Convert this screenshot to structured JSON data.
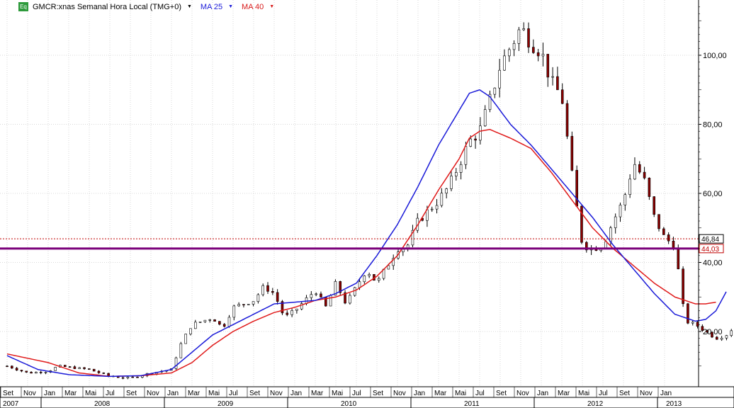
{
  "header": {
    "badge": "Eq",
    "symbol_title": "GMCR:xnas Semanal Hora Local (TMG+0)",
    "ma25_label": "MA 25",
    "ma40_label": "MA 40"
  },
  "colors": {
    "ma25": "#1a1ad8",
    "ma40": "#e01a1a",
    "support_line": "#7a007a",
    "last_price_line": "#c00000",
    "candle_up": "#ffffff",
    "candle_down": "#8b0000",
    "grid": "#d8d8d8"
  },
  "chart_data": {
    "type": "candlestick",
    "ylim": [
      4,
      116
    ],
    "yticks": [
      20,
      40,
      60,
      80,
      100
    ],
    "ytick_labels": [
      "20,00",
      "40,00",
      "60,00",
      "80,00",
      "100,00"
    ],
    "grid": true,
    "month_ticks": [
      "Set",
      "Nov",
      "Jan",
      "Mar",
      "Mai",
      "Jul",
      "Set",
      "Nov",
      "Jan",
      "Mar",
      "Mai",
      "Jul",
      "Set",
      "Nov",
      "Jan",
      "Mar",
      "Mai",
      "Jul",
      "Set",
      "Nov",
      "Jan",
      "Mar",
      "Mai",
      "Jul",
      "Set",
      "Nov",
      "Jan",
      "Mar",
      "Mai",
      "Jul",
      "Set",
      "Nov",
      "Jan"
    ],
    "year_labels": [
      "2007",
      "2008",
      "2009",
      "2010",
      "2011",
      "2012",
      "2013"
    ],
    "year_boundaries_month_index": [
      2,
      8,
      14,
      20,
      26,
      32
    ],
    "price_anchors": [
      [
        0,
        10
      ],
      [
        2,
        8
      ],
      [
        4,
        8.5
      ],
      [
        5,
        10
      ],
      [
        8,
        9
      ],
      [
        10,
        7
      ],
      [
        12,
        6.5
      ],
      [
        14,
        8
      ],
      [
        16,
        9
      ],
      [
        17,
        17
      ],
      [
        18,
        22
      ],
      [
        20,
        24
      ],
      [
        21,
        21
      ],
      [
        22,
        27
      ],
      [
        24,
        29
      ],
      [
        25,
        33
      ],
      [
        26,
        31
      ],
      [
        27,
        24
      ],
      [
        28,
        26
      ],
      [
        30,
        32
      ],
      [
        31,
        27
      ],
      [
        32,
        34
      ],
      [
        33,
        28
      ],
      [
        35,
        38
      ],
      [
        36,
        34
      ],
      [
        38,
        44
      ],
      [
        39,
        45
      ],
      [
        40,
        52
      ],
      [
        42,
        58
      ],
      [
        43,
        62
      ],
      [
        45,
        75
      ],
      [
        46,
        78
      ],
      [
        47,
        87
      ],
      [
        48,
        97
      ],
      [
        50,
        108
      ],
      [
        51,
        104
      ],
      [
        52,
        101
      ],
      [
        53,
        92
      ],
      [
        54,
        88
      ],
      [
        55,
        65
      ],
      [
        56,
        45
      ],
      [
        57,
        44
      ],
      [
        58,
        45
      ],
      [
        59,
        52
      ],
      [
        60,
        58
      ],
      [
        61,
        69
      ],
      [
        62,
        64
      ],
      [
        63,
        53
      ],
      [
        64,
        47
      ],
      [
        65,
        45
      ],
      [
        66,
        23
      ],
      [
        67,
        22
      ],
      [
        68,
        20
      ],
      [
        69,
        18
      ],
      [
        70,
        19
      ],
      [
        71,
        22
      ],
      [
        72,
        24
      ],
      [
        73,
        27
      ],
      [
        74,
        22
      ],
      [
        75,
        24
      ],
      [
        76,
        30
      ],
      [
        77,
        40
      ],
      [
        78,
        42
      ],
      [
        79,
        46.84
      ]
    ],
    "ma25_anchors": [
      [
        0,
        13
      ],
      [
        3,
        9
      ],
      [
        6,
        7.5
      ],
      [
        10,
        7
      ],
      [
        13,
        7.2
      ],
      [
        16,
        9
      ],
      [
        18,
        14
      ],
      [
        20,
        19
      ],
      [
        22,
        22
      ],
      [
        24,
        25
      ],
      [
        26,
        28
      ],
      [
        28,
        28.5
      ],
      [
        30,
        29
      ],
      [
        32,
        31
      ],
      [
        34,
        34
      ],
      [
        36,
        42
      ],
      [
        38,
        51
      ],
      [
        40,
        62
      ],
      [
        42,
        74
      ],
      [
        44,
        84
      ],
      [
        45,
        89
      ],
      [
        46,
        90
      ],
      [
        47,
        88
      ],
      [
        49,
        80
      ],
      [
        51,
        74
      ],
      [
        53,
        67
      ],
      [
        55,
        60
      ],
      [
        57,
        53
      ],
      [
        59,
        45
      ],
      [
        61,
        38
      ],
      [
        63,
        31
      ],
      [
        65,
        25
      ],
      [
        67,
        23
      ],
      [
        68,
        23.5
      ],
      [
        69,
        26
      ],
      [
        70,
        31.5
      ]
    ],
    "ma40_anchors": [
      [
        0,
        13.5
      ],
      [
        4,
        11
      ],
      [
        7,
        8
      ],
      [
        10,
        7
      ],
      [
        13,
        7.2
      ],
      [
        16,
        8
      ],
      [
        18,
        11
      ],
      [
        20,
        16
      ],
      [
        22,
        20
      ],
      [
        24,
        23
      ],
      [
        26,
        25.5
      ],
      [
        28,
        27
      ],
      [
        30,
        29
      ],
      [
        32,
        30
      ],
      [
        34,
        32
      ],
      [
        36,
        36
      ],
      [
        38,
        42
      ],
      [
        40,
        51
      ],
      [
        42,
        61
      ],
      [
        44,
        70
      ],
      [
        45,
        76
      ],
      [
        46,
        78
      ],
      [
        47,
        78.5
      ],
      [
        49,
        76
      ],
      [
        51,
        73
      ],
      [
        53,
        66
      ],
      [
        55,
        58
      ],
      [
        57,
        50
      ],
      [
        59,
        44
      ],
      [
        61,
        39
      ],
      [
        63,
        34
      ],
      [
        65,
        30
      ],
      [
        67,
        28
      ],
      [
        68,
        28
      ],
      [
        69,
        28.5
      ]
    ],
    "horizontal_lines": [
      {
        "value": 44.03,
        "label": "44,03",
        "style": "solid"
      },
      {
        "value": 46.84,
        "label": "46,84",
        "style": "dotted"
      }
    ],
    "last_price": 46.84,
    "support_level": 44.03
  }
}
